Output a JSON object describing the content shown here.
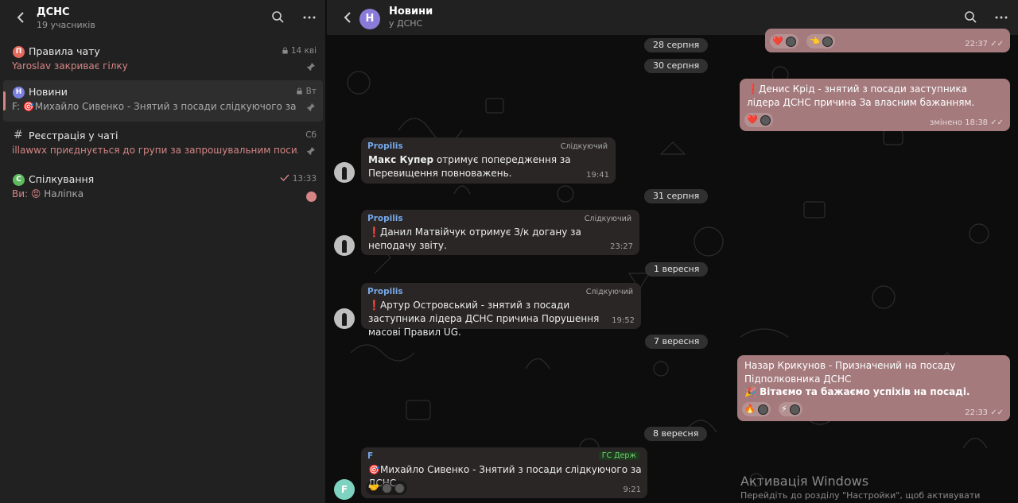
{
  "sidebar": {
    "title": "ДСНС",
    "subtitle": "19 учасників",
    "topics": [
      {
        "avatar": "П",
        "avatar_color": "#e56a5c",
        "name": "Правила чату",
        "meta": "14 кві",
        "prefix": "",
        "last": "Yaroslav закриває гілку"
      },
      {
        "avatar": "Н",
        "avatar_color": "#7b7fe0",
        "name": "Новини",
        "meta": "Вт",
        "prefix": "F: ",
        "last": "Михайло Сивенко - Знятий з посади слідкуючого за ДСНС"
      },
      {
        "avatar": "#",
        "avatar_color": "",
        "name": "Реєстрація у чаті",
        "meta": "Сб",
        "prefix": "",
        "last": "illawwx приєднується до групи за запрошувальним посиланням"
      },
      {
        "avatar": "С",
        "avatar_color": "#5fb95f",
        "name": "Спілкування",
        "meta": "13:33",
        "prefix": "Ви: ",
        "last": "Наліпка"
      }
    ]
  },
  "chat": {
    "title": "Новини",
    "subtitle": "у ДСНС",
    "avatar_letter": "Н",
    "dates": [
      "28 серпня",
      "30 серпня",
      "31 серпня",
      "1 вересня",
      "7 вересня",
      "8 вересня"
    ],
    "messages": [
      {
        "time": "22:37"
      },
      {
        "text": "Денис Крід  - знятий з посади заступника лідера ДСНС причина За власним бажанням.",
        "edited": "змінено",
        "time": "18:38"
      },
      {
        "sender": "Propilis",
        "role": "Слідкуючий",
        "bold": "Макс Купер",
        "text": " отримує  попередження за Перевищення повноважень.",
        "time": "19:41"
      },
      {
        "sender": "Propilis",
        "role": "Слідкуючий",
        "text": "Данил Матвійчук отримує  З/к догану  за неподачу звіту.",
        "time": "23:27"
      },
      {
        "sender": "Propilis",
        "role": "Слідкуючий",
        "text": "Артур Островський  - знятий з посади заступника лідера ДСНС причина Порушення масові Правил UG.",
        "time": "19:52"
      },
      {
        "text": "Назар Крикунов - Призначений на посаду Підполковника ДСНС",
        "bold2": "Вітаємо та бажаємо успіхів на посаді.",
        "time": "22:33"
      },
      {
        "sender": "F",
        "role": "ГС Держ",
        "text": "Михайло Сивенко - Знятий з посади слідкуючого за ДСНС",
        "time": "9:21",
        "avatar": "F"
      }
    ]
  },
  "watermark": {
    "title": "Активація Windows",
    "hint": "Перейдіть до розділу \"Настройки\", щоб активувати"
  },
  "colors": {
    "accent": "#d58585",
    "own_bubble": "#a47a7d",
    "sender": "#76a8e9"
  }
}
